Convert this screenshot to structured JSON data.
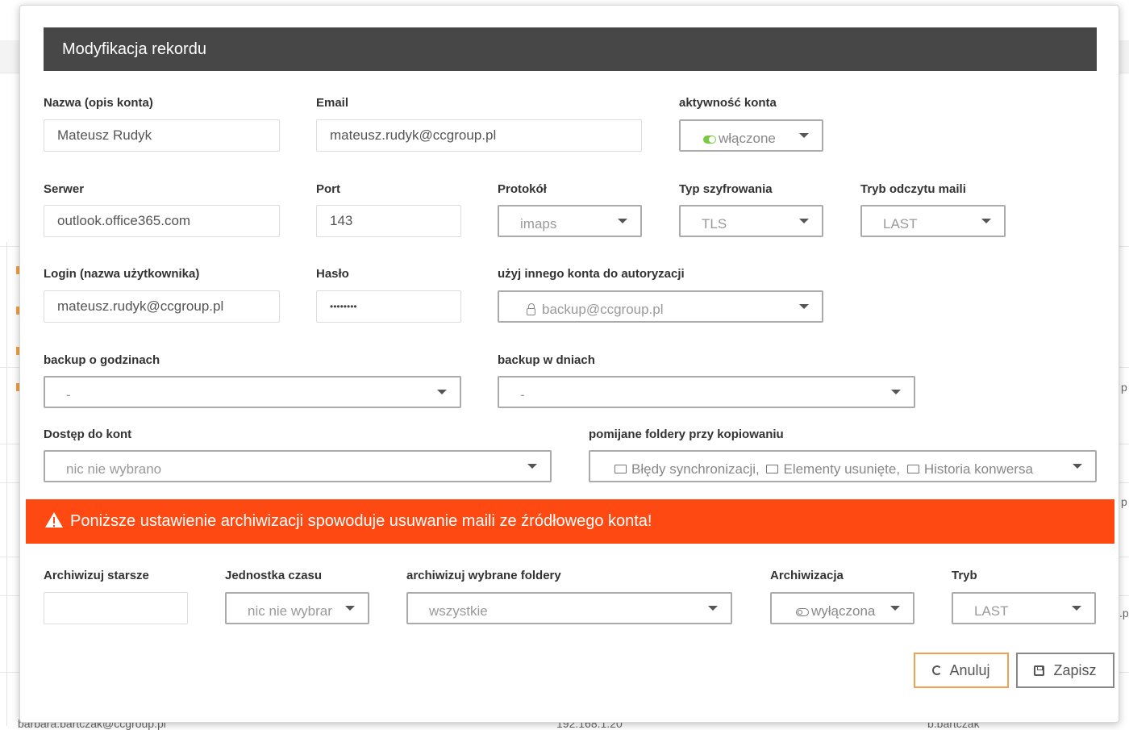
{
  "background": {
    "email_fragment": "barbara.bartczak@ccgroup.pl",
    "number_fragment": "192.168.1.20",
    "name_fragment": "b.bartczak",
    "right_fragments": [
      "p",
      "p",
      ".p"
    ]
  },
  "modal": {
    "title": "Modyfikacja rekordu",
    "fields": {
      "nazwa": {
        "label": "Nazwa (opis konta)",
        "value": "Mateusz Rudyk"
      },
      "email": {
        "label": "Email",
        "value": "mateusz.rudyk@ccgroup.pl"
      },
      "aktywnosc": {
        "label": "aktywność konta",
        "value": "włączone",
        "toggle": "on"
      },
      "serwer": {
        "label": "Serwer",
        "value": "outlook.office365.com"
      },
      "port": {
        "label": "Port",
        "value": "143"
      },
      "protokol": {
        "label": "Protokół",
        "value": "imaps"
      },
      "szyfrowanie": {
        "label": "Typ szyfrowania",
        "value": "TLS"
      },
      "tryb_odczytu": {
        "label": "Tryb odczytu maili",
        "value": "LAST"
      },
      "login": {
        "label": "Login (nazwa użytkownika)",
        "value": "mateusz.rudyk@ccgroup.pl"
      },
      "haslo": {
        "label": "Hasło",
        "value": "••••••••"
      },
      "inne_konto": {
        "label": "użyj innego konta do autoryzacji",
        "value": "backup@ccgroup.pl"
      },
      "backup_godziny": {
        "label": "backup o godzinach",
        "value": "-"
      },
      "backup_dni": {
        "label": "backup w dniach",
        "value": "-"
      },
      "dostep": {
        "label": "Dostęp do kont",
        "value": "nic nie wybrano"
      },
      "pomijane": {
        "label": "pomijane foldery przy kopiowaniu",
        "folders": [
          "Błędy synchronizacji,",
          "Elementy usunięte,",
          "Historia konwersa"
        ]
      }
    },
    "warning": "Poniższe ustawienie archiwizacji spowoduje usuwanie maili ze źródłowego konta!",
    "archive": {
      "starsze": {
        "label": "Archiwizuj starsze",
        "value": ""
      },
      "jednostka": {
        "label": "Jednostka czasu",
        "value": "nic nie wybrar"
      },
      "foldery": {
        "label": "archiwizuj wybrane foldery",
        "value": "wszystkie"
      },
      "archiwizacja": {
        "label": "Archiwizacja",
        "value": "wyłączona",
        "toggle": "off"
      },
      "tryb": {
        "label": "Tryb",
        "value": "LAST"
      }
    },
    "buttons": {
      "cancel": "Anuluj",
      "save": "Zapisz"
    }
  },
  "colors": {
    "header": "#474747",
    "warning": "#fe4a12",
    "toggle_on": "#7ac943",
    "cancel_border": "#f0a050"
  }
}
